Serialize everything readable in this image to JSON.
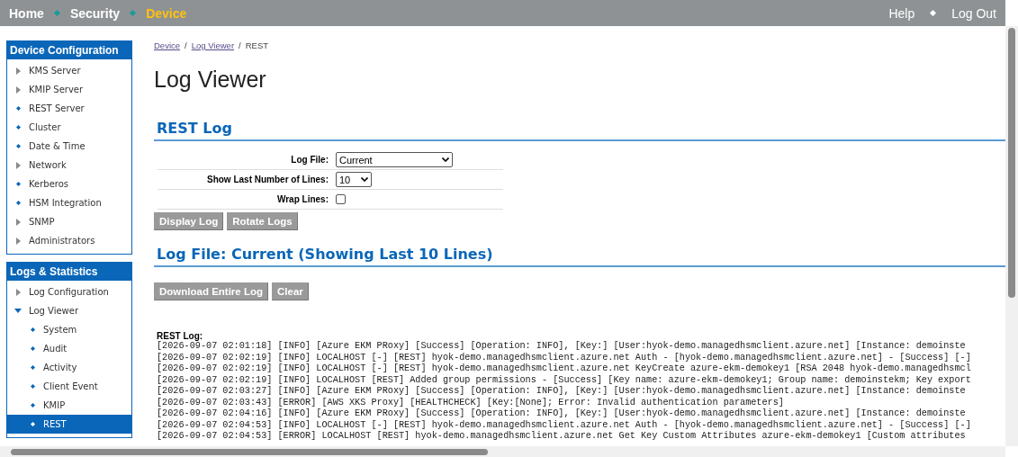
{
  "top_nav": {
    "left": [
      {
        "label": "Home",
        "selected": false
      },
      {
        "label": "Security",
        "selected": false
      },
      {
        "label": "Device",
        "selected": true
      }
    ],
    "right": [
      {
        "label": "Help"
      },
      {
        "label": "Log Out"
      }
    ]
  },
  "sidebar": [
    {
      "title": "Device Configuration",
      "items": [
        {
          "label": "KMS Server",
          "kind": "collapsed",
          "selected": false
        },
        {
          "label": "KMIP Server",
          "kind": "collapsed",
          "selected": false
        },
        {
          "label": "REST Server",
          "kind": "leaf",
          "selected": false
        },
        {
          "label": "Cluster",
          "kind": "leaf",
          "selected": false
        },
        {
          "label": "Date & Time",
          "kind": "leaf",
          "selected": false
        },
        {
          "label": "Network",
          "kind": "collapsed",
          "selected": false
        },
        {
          "label": "Kerberos",
          "kind": "leaf",
          "selected": false
        },
        {
          "label": "HSM Integration",
          "kind": "leaf",
          "selected": false
        },
        {
          "label": "SNMP",
          "kind": "collapsed",
          "selected": false
        },
        {
          "label": "Administrators",
          "kind": "collapsed",
          "selected": false
        }
      ]
    },
    {
      "title": "Logs & Statistics",
      "items": [
        {
          "label": "Log Configuration",
          "kind": "collapsed",
          "selected": false
        },
        {
          "label": "Log Viewer",
          "kind": "expanded",
          "selected": false,
          "children": [
            {
              "label": "System",
              "kind": "leaf",
              "selected": false
            },
            {
              "label": "Audit",
              "kind": "leaf",
              "selected": false
            },
            {
              "label": "Activity",
              "kind": "leaf",
              "selected": false
            },
            {
              "label": "Client Event",
              "kind": "leaf",
              "selected": false
            },
            {
              "label": "KMIP",
              "kind": "leaf",
              "selected": false
            },
            {
              "label": "REST",
              "kind": "leaf",
              "selected": true
            }
          ]
        }
      ]
    }
  ],
  "breadcrumb": {
    "links": [
      "Device",
      "Log Viewer"
    ],
    "separator": "/",
    "current": "REST"
  },
  "page_title": "Log Viewer",
  "section_title": "REST Log",
  "form": [
    {
      "label": "Log File:",
      "kind": "select",
      "value": "Current"
    },
    {
      "label": "Show Last Number of Lines:",
      "kind": "select",
      "value": "10"
    },
    {
      "label": "Wrap Lines:",
      "kind": "checkbox",
      "checked": false
    }
  ],
  "form_buttons": [
    {
      "label": "Display Log",
      "disabled": true
    },
    {
      "label": "Rotate Logs",
      "disabled": true
    }
  ],
  "log_section_title": "Log File: Current (Showing Last 10 Lines)",
  "log_buttons": [
    {
      "label": "Download Entire Log",
      "disabled": true
    },
    {
      "label": "Clear",
      "disabled": true
    }
  ],
  "log": {
    "title": "REST Log:",
    "lines": [
      "[2026-09-07 02:01:18] [INFO] [Azure EKM PRoxy] [Success] [Operation: INFO], [Key:] [User:hyok-demo.managedhsmclient.azure.net] [Instance: demoinste",
      "[2026-09-07 02:02:19] [INFO] LOCALHOST [-] [REST] hyok-demo.managedhsmclient.azure.net Auth - [hyok-demo.managedhsmclient.azure.net] - [Success] [-]",
      "[2026-09-07 02:02:19] [INFO] LOCALHOST [-] [REST] hyok-demo.managedhsmclient.azure.net KeyCreate azure-ekm-demokey1 [RSA 2048 hyok-demo.managedhsmcl",
      "[2026-09-07 02:02:19] [INFO] LOCALHOST [REST] Added group permissions - [Success] [Key name: azure-ekm-demokey1; Group name: demoinstekm; Key export",
      "[2026-09-07 02:03:27] [INFO] [Azure EKM PRoxy] [Success] [Operation: INFO], [Key:] [User:hyok-demo.managedhsmclient.azure.net] [Instance: demoinste",
      "[2026-09-07 02:03:43] [ERROR] [AWS XKS Proxy] [HEALTHCHECK] [Key:[None]; Error: Invalid authentication parameters]",
      "[2026-09-07 02:04:16] [INFO] [Azure EKM PRoxy] [Success] [Operation: INFO], [Key:] [User:hyok-demo.managedhsmclient.azure.net] [Instance: demoinste",
      "[2026-09-07 02:04:53] [INFO] LOCALHOST [-] [REST] hyok-demo.managedhsmclient.azure.net Auth - [hyok-demo.managedhsmclient.azure.net] - [Success] [-]",
      "[2026-09-07 02:04:53] [ERROR] LOCALHOST [REST] hyok-demo.managedhsmclient.azure.net Get Key Custom Attributes azure-ekm-demokey1 [Custom attributes"
    ]
  }
}
